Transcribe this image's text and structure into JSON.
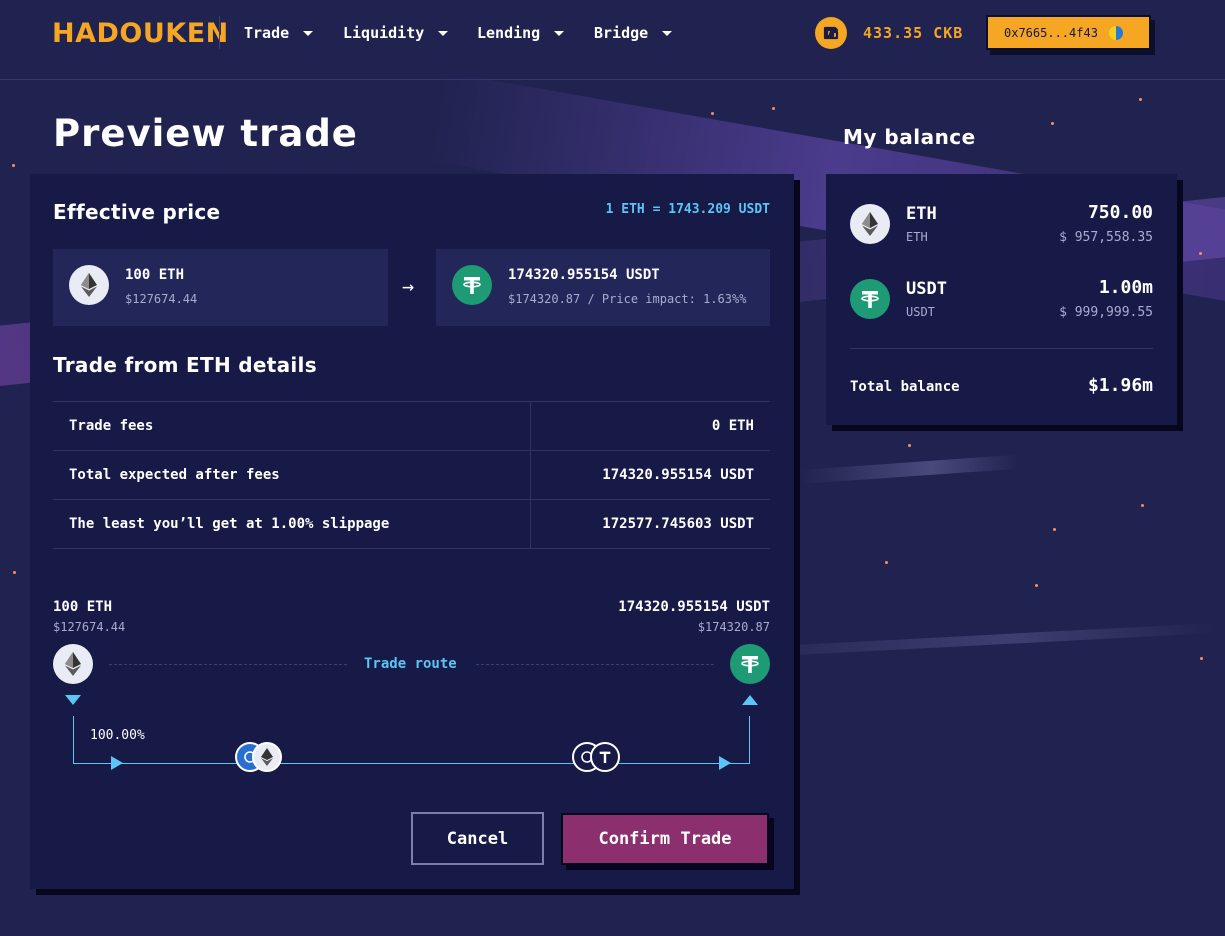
{
  "header": {
    "logo": "HADOUKEN",
    "nav": [
      {
        "label": "Trade"
      },
      {
        "label": "Liquidity"
      },
      {
        "label": "Lending"
      },
      {
        "label": "Bridge"
      }
    ],
    "ckb_balance": "433.35 CKB",
    "wallet_address": "0x7665...4f43"
  },
  "page": {
    "title": "Preview trade"
  },
  "effective_price": {
    "heading": "Effective price",
    "rate": "1 ETH = 1743.209 USDT",
    "from": {
      "amount": "100 ETH",
      "usd": "$127674.44",
      "icon": "eth-icon"
    },
    "to": {
      "amount": "174320.955154 USDT",
      "usd_and_impact": "$174320.87 / Price impact: 1.63%%",
      "icon": "usdt-icon"
    }
  },
  "details": {
    "heading": "Trade from ETH details",
    "rows": [
      {
        "label": "Trade fees",
        "value": "0 ETH"
      },
      {
        "label": "Total expected after fees",
        "value": "174320.955154 USDT"
      },
      {
        "label": "The least you’ll get at 1.00% slippage",
        "value": "172577.745603 USDT"
      }
    ]
  },
  "route": {
    "from_amount": "100 ETH",
    "from_usd": "$127674.44",
    "to_amount": "174320.955154 USDT",
    "to_usd": "$174320.87",
    "label": "Trade route",
    "split_percent": "100.00%"
  },
  "buttons": {
    "cancel": "Cancel",
    "confirm": "Confirm Trade"
  },
  "balance": {
    "title": "My balance",
    "tokens": [
      {
        "symbol": "ETH",
        "sub": "ETH",
        "amount": "750.00",
        "usd": "$ 957,558.35",
        "icon": "eth-icon"
      },
      {
        "symbol": "USDT",
        "sub": "USDT",
        "amount": "1.00m",
        "usd": "$ 999,999.55",
        "icon": "usdt-icon"
      }
    ],
    "total_label": "Total balance",
    "total_value": "$1.96m"
  },
  "colors": {
    "background": "#20224f",
    "card": "#171a47",
    "accent_orange": "#f5a623",
    "accent_blue": "#5bc5f5",
    "confirm_button": "#8c2f6e",
    "eth_icon_bg": "#e9ecf5",
    "usdt_icon_bg": "#1e9b74"
  }
}
